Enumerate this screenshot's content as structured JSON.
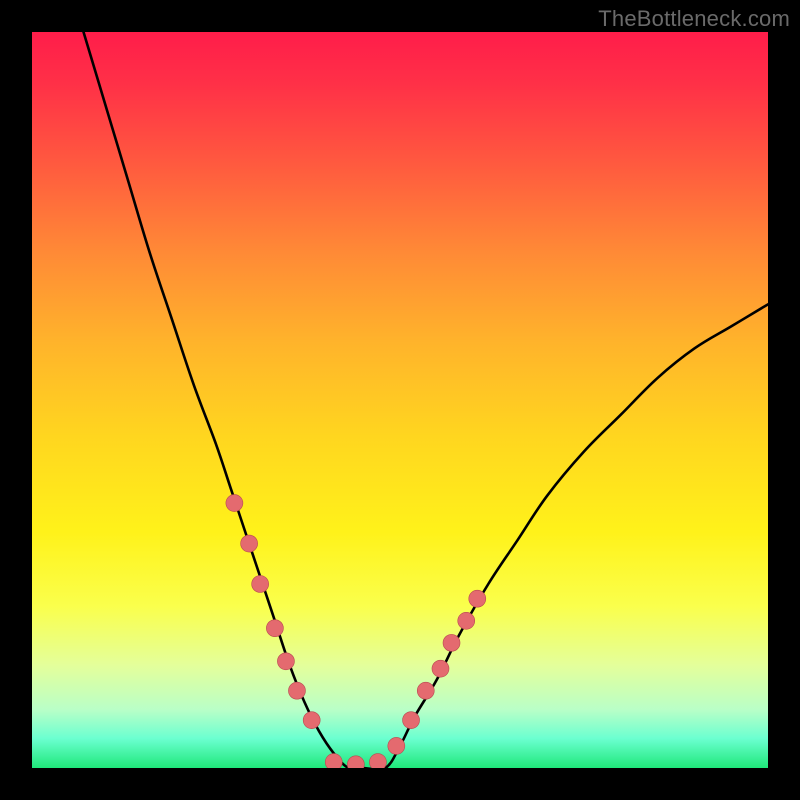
{
  "watermark": "TheBottleneck.com",
  "colors": {
    "frame": "#000000",
    "gradient_top": "#ff1d4a",
    "gradient_bottom": "#1fe87a",
    "curve": "#000000",
    "dot_fill": "#e46a6f",
    "dot_stroke": "#b84a50"
  },
  "chart_data": {
    "type": "line",
    "title": "",
    "xlabel": "",
    "ylabel": "",
    "xlim": [
      0,
      100
    ],
    "ylim": [
      0,
      100
    ],
    "series": [
      {
        "name": "bottleneck-curve",
        "x": [
          7,
          10,
          13,
          16,
          19,
          22,
          25,
          27,
          29,
          31,
          33,
          35,
          37,
          39,
          41,
          43,
          45,
          48,
          50,
          52,
          55,
          58,
          62,
          66,
          70,
          75,
          80,
          85,
          90,
          95,
          100
        ],
        "y": [
          100,
          90,
          80,
          70,
          61,
          52,
          44,
          38,
          32,
          26,
          20,
          14,
          9,
          5,
          2,
          0,
          0,
          0,
          3,
          7,
          12,
          18,
          25,
          31,
          37,
          43,
          48,
          53,
          57,
          60,
          63
        ]
      }
    ],
    "markers": {
      "name": "highlight-dots",
      "x": [
        27.5,
        29.5,
        31.0,
        33.0,
        34.5,
        36.0,
        38.0,
        41.0,
        44.0,
        47.0,
        49.5,
        51.5,
        53.5,
        55.5,
        57.0,
        59.0,
        60.5
      ],
      "y": [
        36.0,
        30.5,
        25.0,
        19.0,
        14.5,
        10.5,
        6.5,
        0.8,
        0.5,
        0.8,
        3.0,
        6.5,
        10.5,
        13.5,
        17.0,
        20.0,
        23.0
      ]
    }
  }
}
